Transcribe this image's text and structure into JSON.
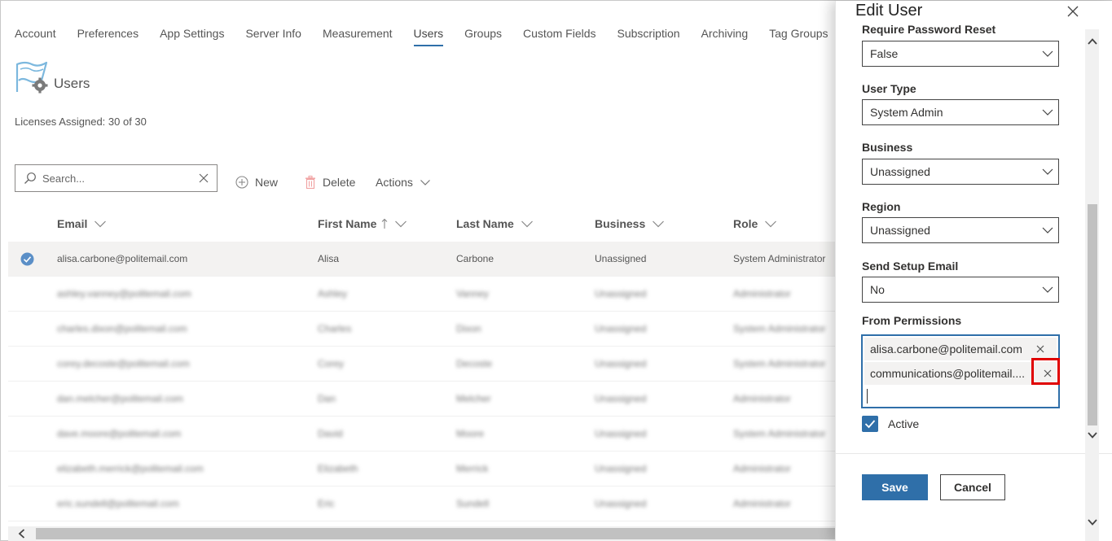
{
  "nav": {
    "tabs": [
      {
        "label": "Account"
      },
      {
        "label": "Preferences"
      },
      {
        "label": "App Settings"
      },
      {
        "label": "Server Info"
      },
      {
        "label": "Measurement"
      },
      {
        "label": "Users",
        "active": true
      },
      {
        "label": "Groups"
      },
      {
        "label": "Custom Fields"
      },
      {
        "label": "Subscription"
      },
      {
        "label": "Archiving"
      },
      {
        "label": "Tag Groups"
      }
    ]
  },
  "header": {
    "title": "Users",
    "licenses": "Licenses Assigned: 30 of 30"
  },
  "toolbar": {
    "search_placeholder": "Search...",
    "new_label": "New",
    "delete_label": "Delete",
    "actions_label": "Actions"
  },
  "table": {
    "columns": [
      "Email",
      "First Name",
      "Last Name",
      "Business",
      "Role"
    ],
    "rows": [
      [
        "alisa.carbone@politemail.com",
        "Alisa",
        "Carbone",
        "Unassigned",
        "System Administrator"
      ],
      [
        "ashley.vanney@politemail.com",
        "Ashley",
        "Vanney",
        "Unassigned",
        "Administrator"
      ],
      [
        "charles.dixon@politemail.com",
        "Charles",
        "Dixon",
        "Unassigned",
        "System Administrator"
      ],
      [
        "corey.decoste@politemail.com",
        "Corey",
        "Decoste",
        "Unassigned",
        "System Administrator"
      ],
      [
        "dan.melcher@politemail.com",
        "Dan",
        "Melcher",
        "Unassigned",
        "Administrator"
      ],
      [
        "dave.moore@politemail.com",
        "David",
        "Moore",
        "Unassigned",
        "System Administrator"
      ],
      [
        "elizabeth.merrick@politemail.com",
        "Elizabeth",
        "Merrick",
        "Unassigned",
        "Administrator"
      ],
      [
        "eric.sundell@politemail.com",
        "Eric",
        "Sundell",
        "Unassigned",
        "Administrator"
      ]
    ]
  },
  "panel": {
    "title": "Edit User",
    "fields": {
      "require_password_reset": {
        "label": "Require Password Reset",
        "value": "False"
      },
      "user_type": {
        "label": "User Type",
        "value": "System Admin"
      },
      "business": {
        "label": "Business",
        "value": "Unassigned"
      },
      "region": {
        "label": "Region",
        "value": "Unassigned"
      },
      "send_setup_email": {
        "label": "Send Setup Email",
        "value": "No"
      },
      "from_permissions": {
        "label": "From Permissions",
        "chips": [
          "alisa.carbone@politemail.com",
          "communications@politemail...."
        ]
      }
    },
    "active_label": "Active",
    "active_checked": true,
    "save_label": "Save",
    "cancel_label": "Cancel"
  },
  "colors": {
    "accent": "#2f6fa9",
    "highlight": "#e00000"
  }
}
